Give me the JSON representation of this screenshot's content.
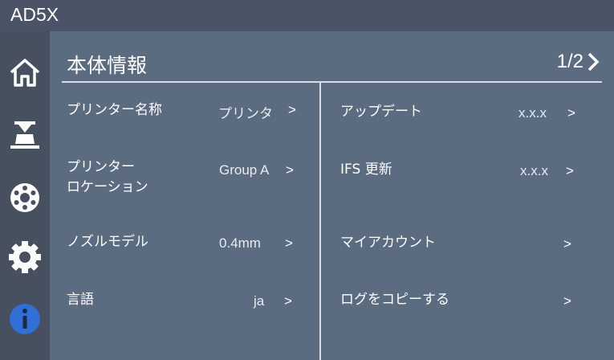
{
  "header": {
    "device_name": "AD5X"
  },
  "sidebar": {
    "items": [
      {
        "icon": "home-icon"
      },
      {
        "icon": "print-bed-icon"
      },
      {
        "icon": "filament-spool-icon"
      },
      {
        "icon": "gear-icon"
      },
      {
        "icon": "info-icon",
        "active": true,
        "accent": "#2f6fd6"
      }
    ]
  },
  "page": {
    "title": "本体情報",
    "pager": "1/2"
  },
  "left_items": [
    {
      "label": "プリンター名称",
      "value": "プリンタ",
      "arrow": ">"
    },
    {
      "label_line1": "プリンター",
      "label_line2": "ロケーション",
      "value": "Group A",
      "arrow": ">"
    },
    {
      "label": "ノズルモデル",
      "value": "0.4mm",
      "arrow": ">"
    },
    {
      "label": "言語",
      "value": "ja",
      "arrow": ">"
    }
  ],
  "right_items": [
    {
      "label": "アップデート",
      "value": "x.x.x",
      "arrow": ">"
    },
    {
      "label": "IFS 更新",
      "value": "x.x.x",
      "arrow": ">"
    },
    {
      "label": "マイアカウント",
      "arrow": ">"
    },
    {
      "label": "ログをコピーする",
      "arrow": ">"
    }
  ]
}
